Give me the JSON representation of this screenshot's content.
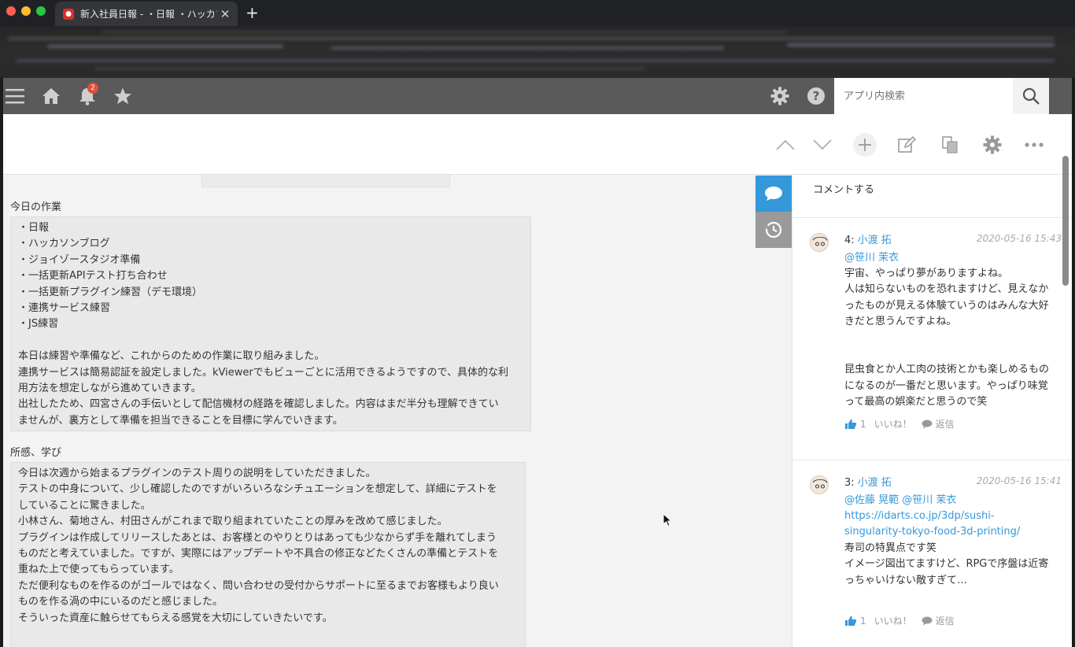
{
  "browser": {
    "tab_title": "新入社員日報 - ・日報 ・ハッカソ",
    "tab_close": "✕",
    "new_tab": "+"
  },
  "header": {
    "notification_count": "2",
    "search_placeholder": "アプリ内検索"
  },
  "record": {
    "work_label": "今日の作業",
    "work_text": "・日報\n・ハッカソンブログ\n・ジョイゾースタジオ準備\n・一括更新APIテスト打ち合わせ\n・一括更新プラグイン練習（デモ環境）\n・連携サービス練習\n・JS練習\n\n本日は練習や準備など、これからのための作業に取り組みました。\n連携サービスは簡易認証を設定しました。kViewerでもビューごとに活用できるようですので、具体的な利\n用方法を想定しながら進めていきます。\n出社したため、四宮さんの手伝いとして配信機材の経路を確認しました。内容はまだ半分も理解できてい\nませんが、裏方として準備を担当できることを目標に学んでいきます。",
    "learn_label": "所感、学び",
    "learn_text": "今日は次週から始まるプラグインのテスト周りの説明をしていただきました。\nテストの中身について、少し確認したのですがいろいろなシチュエーションを想定して、詳細にテストを\nしていることに驚きました。\n小林さん、菊地さん、村田さんがこれまで取り組まれていたことの厚みを改めて感じました。\nプラグインは作成してリリースしたあとは、お客様とのやりとりはあっても少なからず手を離れてしまう\nものだと考えていました。ですが、実際にはアップデートや不具合の修正などたくさんの準備とテストを\n重ねた上で使ってもらっています。\nただ便利なものを作るのがゴールではなく、問い合わせの受付からサポートに至るまでお客様もより良い\nものを作る渦の中にいるのだと感じました。\nそういった資産に触らせてもらえる感覚を大切にしていきたいです。"
  },
  "comments": {
    "prompt": "コメントする",
    "items": [
      {
        "number": "4:",
        "author": "小渡 拓",
        "date": "2020-05-16 15:43",
        "mention": "@笹川 茉衣",
        "body": "宇宙、やっぱり夢がありますよね。\n人は知らないものを恐れますけど、見えなか\nったものが見える体験ていうのはみんな大好\nきだと思うんですよね。\n\n\n昆虫食とか人工肉の技術とかも楽しめるもの\nになるのが一番だと思います。やっぱり味覚\nって最高の娯楽だと思うので笑",
        "like_count": "1",
        "like_label": "いいね！",
        "reply_label": "返信"
      },
      {
        "number": "3:",
        "author": "小渡 拓",
        "date": "2020-05-16 15:41",
        "mention": "@佐藤 晃範 @笹川 茉衣",
        "link": "https://idarts.co.jp/3dp/sushi-\nsingularity-tokyo-food-3d-printing/",
        "body": "寿司の特異点です笑\nイメージ図出てますけど、RPGで序盤は近寄\nっちゃいけない敵すぎて…",
        "like_count": "1",
        "like_label": "いいね！",
        "reply_label": "返信"
      }
    ]
  },
  "colors": {
    "accent": "#3498db",
    "header_bg": "#5a5a5a",
    "badge": "#e0503c"
  }
}
